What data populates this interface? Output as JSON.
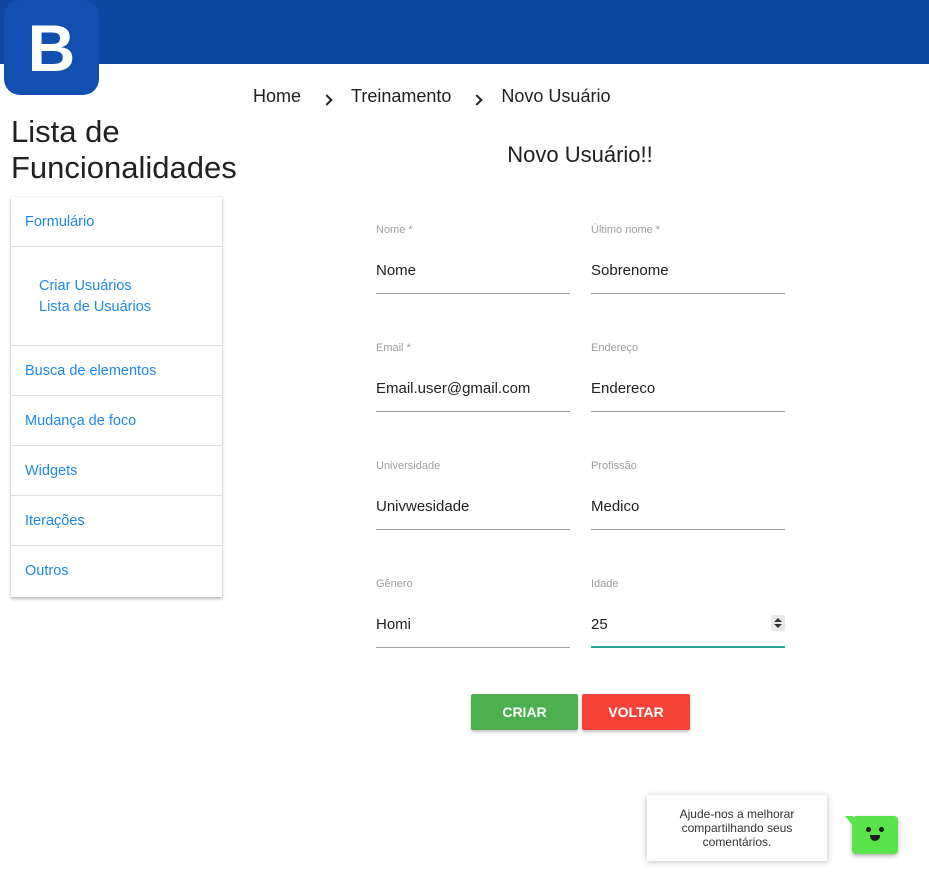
{
  "header": {
    "logo_letter": "B"
  },
  "breadcrumb": [
    "Home",
    "Treinamento",
    "Novo Usuário"
  ],
  "sidebar": {
    "title_line1": "Lista de",
    "title_line2": "Funcionalidades",
    "items": [
      {
        "label": "Formulário"
      },
      {
        "label": "Busca de elementos"
      },
      {
        "label": "Mudança de foco"
      },
      {
        "label": "Widgets"
      },
      {
        "label": "Iterações"
      },
      {
        "label": "Outros"
      }
    ],
    "subitems": [
      "Criar Usuários",
      "Lista de Usuários"
    ]
  },
  "form": {
    "title": "Novo Usuário!!",
    "fields": [
      {
        "label": "Nome *",
        "value": "Nome"
      },
      {
        "label": "Último nome *",
        "value": "Sobrenome"
      },
      {
        "label": "Email *",
        "value": "Email.user@gmail.com"
      },
      {
        "label": "Endereço",
        "value": "Endereco"
      },
      {
        "label": "Universidade",
        "value": "Univwesidade"
      },
      {
        "label": "Profissão",
        "value": "Medico"
      },
      {
        "label": "Gênero",
        "value": "Homi"
      },
      {
        "label": "Idade",
        "value": "25"
      }
    ],
    "create_label": "CRIAR",
    "back_label": "VOLTAR"
  },
  "feedback": {
    "line1": "Ajude-nos a melhorar",
    "line2": "compartilhando seus",
    "line3": "comentários."
  },
  "colors": {
    "header": "#0d47a1",
    "link": "#1e88e5",
    "create": "#4caf50",
    "back": "#f44336",
    "focus": "#26a69a",
    "bot": "#5ae34b"
  }
}
